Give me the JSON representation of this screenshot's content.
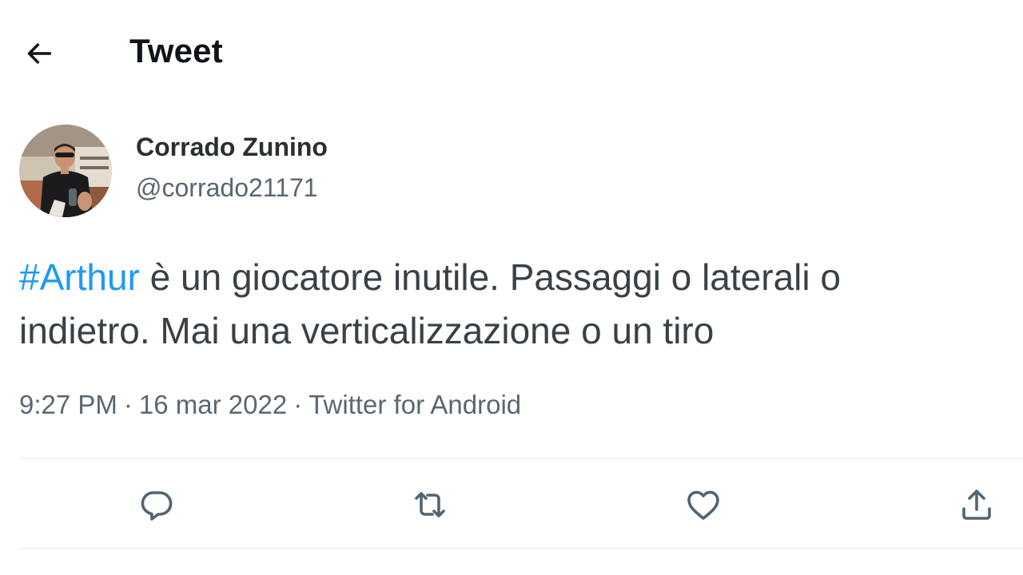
{
  "header": {
    "title": "Tweet",
    "back_icon": "arrow-left-icon"
  },
  "author": {
    "name": "Corrado Zunino",
    "handle": "@corrado21171",
    "avatar_icon": "user-avatar-photo"
  },
  "tweet": {
    "hashtag": "#Arthur",
    "text_line1": " è un giocatore inutile. Passaggi o laterali o",
    "text_line2": "indietro. Mai una verticalizzazione o un tiro"
  },
  "meta": {
    "time": "9:27 PM",
    "separator": "·",
    "date": "16 mar 2022",
    "source": "Twitter for Android"
  },
  "actions": [
    {
      "name": "reply",
      "icon": "reply-icon"
    },
    {
      "name": "retweet",
      "icon": "retweet-icon"
    },
    {
      "name": "like",
      "icon": "heart-icon"
    },
    {
      "name": "share",
      "icon": "share-icon"
    }
  ],
  "colors": {
    "link": "#1d9bf0",
    "text": "#0f1419",
    "secondary": "#5b6670",
    "divider": "#e8ecef"
  }
}
